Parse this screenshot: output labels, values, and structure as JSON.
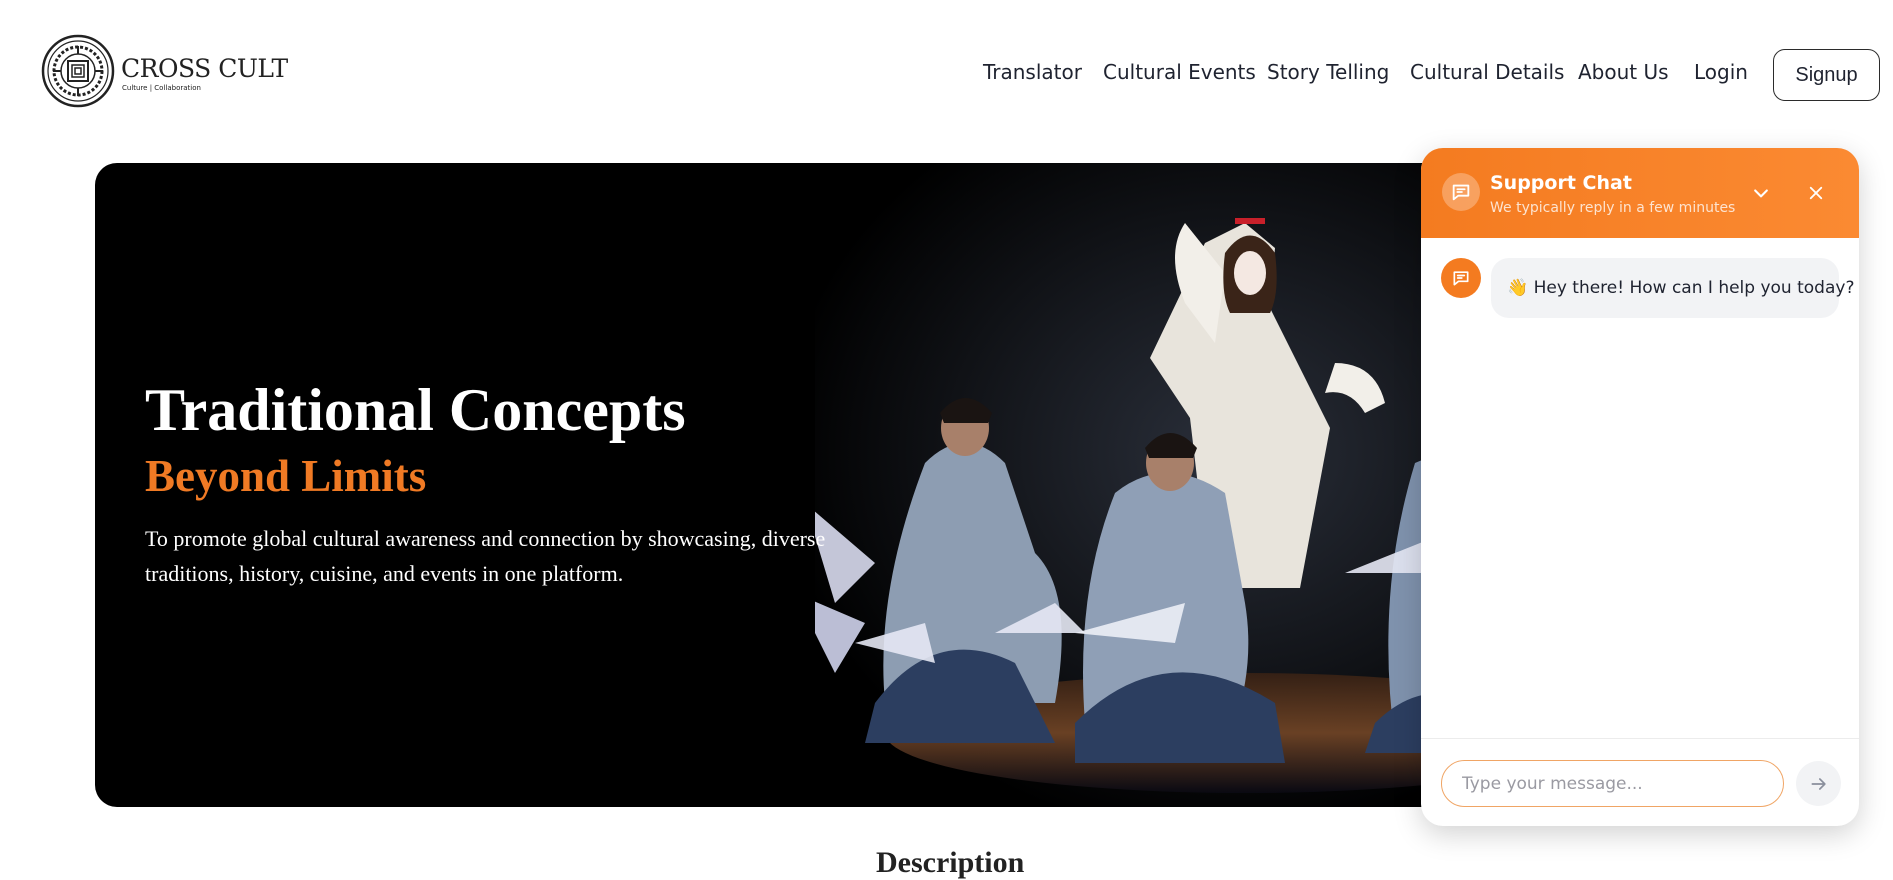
{
  "brand": {
    "name": "CROSS CULT",
    "tagline": "Culture | Collaboration"
  },
  "nav": {
    "items": [
      {
        "label": "Translator"
      },
      {
        "label": "Cultural Events"
      },
      {
        "label": "Story Telling"
      },
      {
        "label": "Cultural Details"
      },
      {
        "label": "About Us"
      },
      {
        "label": "Login"
      }
    ],
    "signup_label": "Signup"
  },
  "hero": {
    "title": "Traditional Concepts",
    "accent": "Beyond Limits",
    "description": "To promote global cultural awareness and connection by showcasing, diverse traditions, history, cuisine, and events in one platform."
  },
  "section": {
    "heading": "Description"
  },
  "chat": {
    "title": "Support Chat",
    "subtitle": "We typically reply in a few minutes",
    "messages": [
      {
        "sender": "bot",
        "text": "👋 Hey there! How can I help you today?"
      }
    ],
    "input_placeholder": "Type your message...",
    "icons": {
      "header": "chat-bubble-icon",
      "minimize": "chevron-down-icon",
      "close": "close-icon",
      "send": "arrow-right-icon"
    }
  },
  "colors": {
    "accent": "#f47b20",
    "hero_bg": "#000000",
    "text_dark": "#1f2330"
  }
}
